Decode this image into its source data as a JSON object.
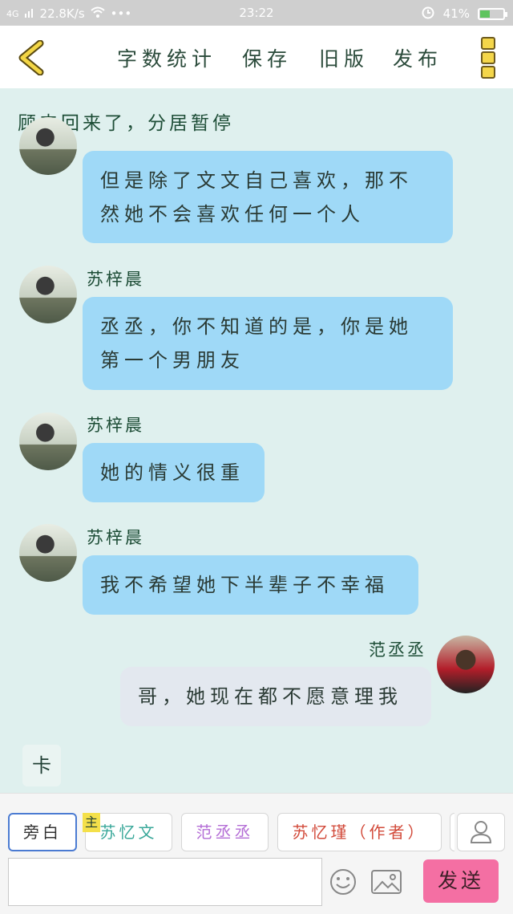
{
  "status_bar": {
    "network": "4G",
    "speed": "22.8K/s",
    "dots": "•••",
    "time": "23:22",
    "battery": "41%",
    "battery_level": 0.41
  },
  "toolbar": {
    "word_count": "字数统计",
    "save": "保存",
    "old_version": "旧版",
    "publish": "发布"
  },
  "chapter_title": "顾卉回来了，分居暂停",
  "messages": [
    {
      "speaker": "",
      "side": "left",
      "text": "但是除了文文自己喜欢，那不然她不会喜欢任何一个人"
    },
    {
      "speaker": "苏梓晨",
      "side": "left",
      "text": "丞丞，你不知道的是，你是她第一个男朋友"
    },
    {
      "speaker": "苏梓晨",
      "side": "left",
      "text": "她的情义很重"
    },
    {
      "speaker": "苏梓晨",
      "side": "left",
      "text": "我不希望她下半辈子不幸福"
    },
    {
      "speaker": "范丞丞",
      "side": "right",
      "text": "哥，她现在都不愿意理我"
    }
  ],
  "card_label": "卡",
  "roles": {
    "narrator": "旁白",
    "main_mark": "主",
    "su_yiwen": "苏忆文",
    "fan_chengcheng": "范丞丞",
    "su_yijin": "苏忆瑾（作者）"
  },
  "role_colors": {
    "su_yiwen": "#3aa89a",
    "fan_chengcheng": "#b46ed6",
    "su_yijin": "#d24a3a"
  },
  "input": {
    "placeholder": ""
  },
  "send_label": "发送"
}
